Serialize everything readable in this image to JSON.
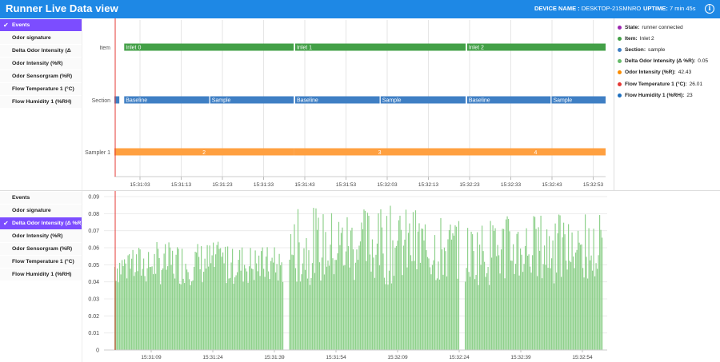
{
  "header": {
    "title": "Runner Live Data view",
    "device_label": "DEVICE NAME :",
    "device_name": "DESKTOP-21SMNRO",
    "uptime_label": "UPTIME:",
    "uptime_value": "7 min 45s",
    "info_icon": "info-icon",
    "bg_color": "#1e88e5"
  },
  "top_menu": [
    {
      "label": "Events",
      "selected": true
    },
    {
      "label": "Odor signature",
      "selected": false
    },
    {
      "label": "Delta Odor Intensity (Δ",
      "selected": false
    },
    {
      "label": "Odor Intensity (%R)",
      "selected": false
    },
    {
      "label": "Odor Sensorgram (%R)",
      "selected": false
    },
    {
      "label": "Flow Temperature 1 (°C)",
      "selected": false
    },
    {
      "label": "Flow Humidity 1 (%RH)",
      "selected": false
    }
  ],
  "bottom_menu": [
    {
      "label": "Events",
      "selected": false
    },
    {
      "label": "Odor signature",
      "selected": false
    },
    {
      "label": "Delta Odor Intensity (Δ %R)",
      "selected": true
    },
    {
      "label": "Odor Intensity (%R)",
      "selected": false
    },
    {
      "label": "Odor Sensorgram (%R)",
      "selected": false
    },
    {
      "label": "Flow Temperature 1 (°C)",
      "selected": false
    },
    {
      "label": "Flow Humidity 1 (%RH)",
      "selected": false
    }
  ],
  "legend": [
    {
      "label": "State:",
      "value": "runner connected",
      "color": "#9c27b0"
    },
    {
      "label": "Item:",
      "value": "Inlet 2",
      "color": "#43a047"
    },
    {
      "label": "Section:",
      "value": "sample",
      "color": "#3f7fc4"
    },
    {
      "label": "Delta Odor Intensity (Δ %R):",
      "value": "0.05",
      "color": "#66bb6a"
    },
    {
      "label": "Odor Intensity (%R):",
      "value": "42.43",
      "color": "#fb8c00"
    },
    {
      "label": "Flow Temperature 1 (°C):",
      "value": "26.01",
      "color": "#e53935"
    },
    {
      "label": "Flow Humidity 1 (%RH):",
      "value": "23",
      "color": "#1e6fbf"
    }
  ],
  "events_chart": {
    "row_labels": [
      "Item",
      "Section",
      "Sampler 1"
    ],
    "items": [
      {
        "label": "Inlet 0",
        "start": 0.02,
        "end": 0.365
      },
      {
        "label": "Inlet 1",
        "start": 0.368,
        "end": 0.715
      },
      {
        "label": "Inlet 2",
        "start": 0.718,
        "end": 1.0
      }
    ],
    "sections": [
      {
        "label": "",
        "start": 0.0,
        "end": 0.01
      },
      {
        "label": "Baseline",
        "start": 0.02,
        "end": 0.193
      },
      {
        "label": "Sample",
        "start": 0.195,
        "end": 0.365
      },
      {
        "label": "Baseline",
        "start": 0.368,
        "end": 0.54
      },
      {
        "label": "Sample",
        "start": 0.542,
        "end": 0.715
      },
      {
        "label": "Baseline",
        "start": 0.718,
        "end": 0.888
      },
      {
        "label": "Sample",
        "start": 0.89,
        "end": 1.0
      }
    ],
    "sampler": [
      {
        "label": "2",
        "start": 0.0,
        "end": 0.365
      },
      {
        "label": "3",
        "start": 0.365,
        "end": 0.715
      },
      {
        "label": "4",
        "start": 0.715,
        "end": 1.0
      }
    ],
    "x_ticks": [
      "15:31:03",
      "15:31:13",
      "15:31:23",
      "15:31:33",
      "15:31:43",
      "15:31:53",
      "15:32:03",
      "15:32:13",
      "15:32:23",
      "15:32:33",
      "15:32:43",
      "15:32:53"
    ],
    "colors": {
      "item": "#43a047",
      "section": "#3f7fc4",
      "sampler": "#ffa040",
      "marker": "#e53935"
    }
  },
  "chart_data": {
    "type": "bar",
    "ylim": [
      0,
      0.09
    ],
    "y_ticks": [
      "0",
      "0.01",
      "0.02",
      "0.03",
      "0.04",
      "0.05",
      "0.06",
      "0.07",
      "0.08",
      "0.09"
    ],
    "x_ticks": [
      "15:31:09",
      "15:31:24",
      "15:31:39",
      "15:31:54",
      "15:32:09",
      "15:32:24",
      "15:32:39",
      "15:32:54"
    ],
    "color": "#8fd18c",
    "segments": [
      {
        "start_frac": 0.0,
        "end_frac": 0.346,
        "base": 0.038,
        "peak": 0.064
      },
      {
        "start_frac": 0.358,
        "end_frac": 0.706,
        "base": 0.038,
        "peak": 0.085
      },
      {
        "start_frac": 0.718,
        "end_frac": 1.0,
        "base": 0.038,
        "peak": 0.081
      }
    ]
  }
}
